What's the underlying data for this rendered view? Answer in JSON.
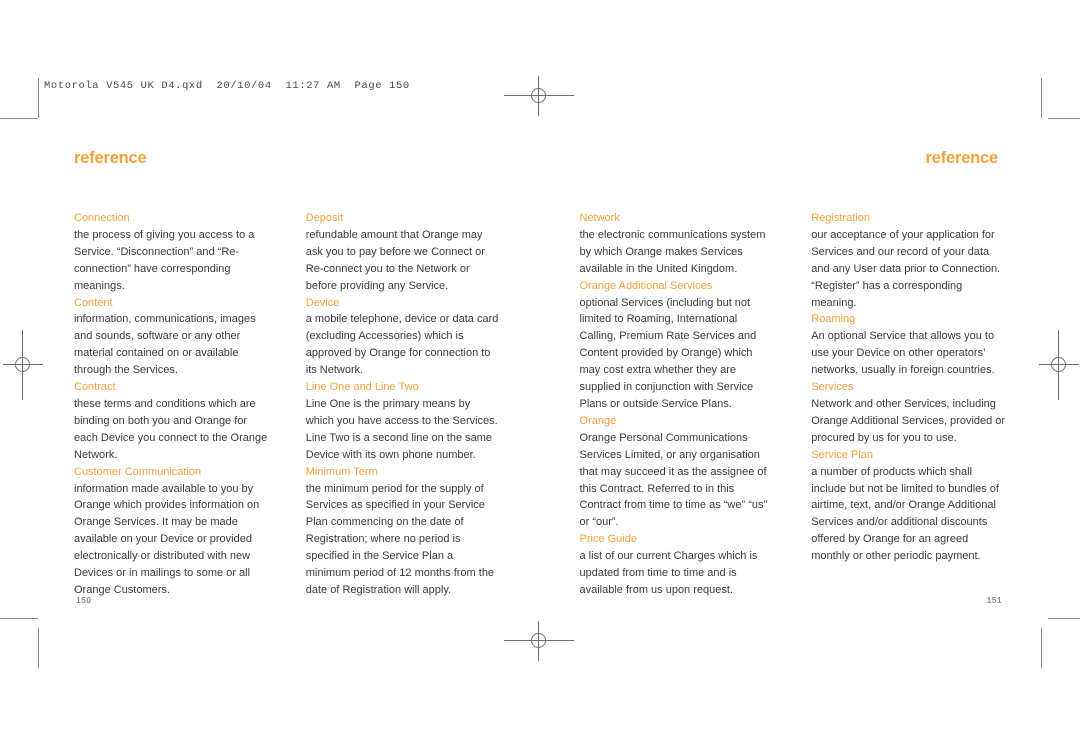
{
  "slug": {
    "text": "Motorola V545 UK D4.qxd  20/10/04  11:27 AM  Page 150"
  },
  "running_head": {
    "left": "reference",
    "right": "reference"
  },
  "folios": {
    "left": "150",
    "right": "151"
  },
  "colors": {
    "accent_orange": "#f5a03c",
    "body_text": "#3b3b3b",
    "folio_gray": "#8d8d8d",
    "mark_gray": "#8a8a8a"
  },
  "columns": [
    {
      "id": "column-1",
      "entries": [
        {
          "term": "Connection",
          "definition": "the process of giving you access to a Service. “Disconnection” and “Re-connection” have corresponding meanings."
        },
        {
          "term": "Content",
          "definition": "information, communications, images and sounds, software or any other material contained on or available through the Services."
        },
        {
          "term": "Contract",
          "definition": "these terms and conditions which are binding on both you and Orange for each Device you connect to the Orange Network."
        },
        {
          "term": "Customer Communication",
          "definition": "information made available to you by Orange which provides information on Orange Services. It may be made available on your Device or provided electronically or distributed with new Devices or in mailings to some or all Orange Customers."
        }
      ]
    },
    {
      "id": "column-2",
      "entries": [
        {
          "term": "Deposit",
          "definition": "refundable amount that Orange may ask you to pay before we Connect or Re-connect you to the Network or before providing any Service."
        },
        {
          "term": "Device",
          "definition": "a mobile telephone, device or data card (excluding Accessories) which is approved by Orange for connection to its Network."
        },
        {
          "term": "Line One and Line Two",
          "definition": "Line One is the primary means by which you have access to the Services. Line Two is a second line on the same Device with its own phone number."
        },
        {
          "term": "Minimum Term",
          "definition": "the minimum period for the supply of Services as specified in your Service Plan commencing on the date of Registration; where no period is specified in the Service Plan a minimum period of 12 months from the date of Registration will apply."
        }
      ]
    },
    {
      "id": "column-3",
      "entries": [
        {
          "term": "Network",
          "definition": "the electronic communications system by which Orange makes Services available in the United Kingdom."
        },
        {
          "term": "Orange Additional Services",
          "definition": "optional Services (including but not limited to Roaming, International Calling, Premium Rate Services and Content provided by Orange) which may cost extra whether they are supplied in conjunction with Service Plans or outside Service Plans."
        },
        {
          "term": "Orange",
          "definition": "Orange Personal Communications Services Limited, or any organisation that may succeed it as the assignee of this Contract. Referred to in this Contract from time to time as “we” “us” or “our”."
        },
        {
          "term": "Price Guide",
          "definition": "a list of our current Charges which is updated from time to time and is available from us upon request."
        }
      ]
    },
    {
      "id": "column-4",
      "entries": [
        {
          "term": "Registration",
          "definition": "our acceptance of your application for Services and our record of your data and any User data prior to Connection. “Register” has a corresponding meaning."
        },
        {
          "term": "Roaming",
          "definition": "An optional Service that allows you to use your Device on other operators’ networks, usually in foreign countries."
        },
        {
          "term": "Services",
          "definition": "Network and other Services, including Orange Additional Services, provided or procured by us for you to use."
        },
        {
          "term": "Service Plan",
          "definition": "a number of products which shall include but not be limited to bundles of airtime, text, and/or Orange Additional Services and/or additional discounts offered by Orange for an agreed monthly or other periodic payment."
        }
      ]
    }
  ]
}
